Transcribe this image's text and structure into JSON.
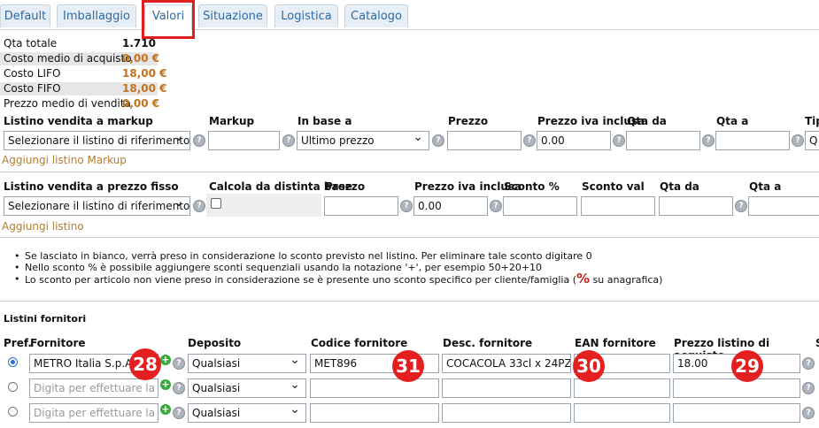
{
  "tabs": [
    "Default",
    "Imballaggio",
    "Valori",
    "Situazione",
    "Logistica",
    "Catalogo"
  ],
  "values": {
    "qta_totale_label": "Qta totale",
    "qta_totale_value": "1.710",
    "costo_medio_label": "Costo medio di acquisto",
    "costo_medio_value": "0,00 €",
    "costo_lifo_label": "Costo LIFO",
    "costo_lifo_value": "18,00 €",
    "costo_fifo_label": "Costo FIFO",
    "costo_fifo_value": "18,00 €",
    "prezzo_medio_label": "Prezzo medio di vendita",
    "prezzo_medio_value": "0,00 €"
  },
  "markup": {
    "headers": [
      "Listino vendita a markup",
      "Markup",
      "In base a",
      "Prezzo",
      "Prezzo iva inclusa",
      "Qta da",
      "Qta a",
      "Tip"
    ],
    "listino_select": "Selezionare il listino di riferimento",
    "in_base_select": "Ultimo prezzo",
    "prezzo_iva": "0.00",
    "tipo_value": "Q",
    "add_link": "Aggiungi listino Markup"
  },
  "fisso": {
    "headers": [
      "Listino vendita a prezzo fisso",
      "Calcola da distinta base",
      "Prezzo",
      "Prezzo iva inclusa",
      "Sconto %",
      "Sconto val",
      "Qta da",
      "Qta a"
    ],
    "listino_select": "Selezionare il listino di riferimento",
    "prezzo_iva": "0.00",
    "add_link": "Aggiungi listino"
  },
  "notes": {
    "n1": "Se lasciato in bianco, verrà preso in considerazione lo sconto previsto nel listino. Per eliminare tale sconto digitare 0",
    "n2": "Nello sconto % è possibile aggiungere sconti sequenziali usando la notazione '+', per esempio 50+20+10",
    "n3a": "Lo sconto per articolo non viene preso in considerazione se è presente uno sconto specifico per cliente/famiglia (",
    "n3b": " su anagrafica)",
    "pct": "%"
  },
  "fornitori": {
    "title": "Listini fornitori",
    "headers": [
      "Pref.",
      "Fornitore",
      "Deposito",
      "Codice fornitore",
      "Desc. fornitore",
      "EAN fornitore",
      "Prezzo listino di acquisto",
      "S"
    ],
    "rows": [
      {
        "fornitore": "METRO Italia S.p.A.",
        "deposito": "Qualsiasi",
        "codice": "MET896",
        "desc": "COCACOLA 33cl x 24PZ",
        "ean": "",
        "prezzo": "18.00"
      },
      {
        "fornitore_placeholder": "Digita per effettuare la ric",
        "deposito": "Qualsiasi"
      },
      {
        "fornitore_placeholder": "Digita per effettuare la ric",
        "deposito": "Qualsiasi"
      }
    ]
  },
  "badges": [
    "28",
    "31",
    "30",
    "29"
  ],
  "colors": {
    "accent": "#2b6aa6",
    "orange": "#c0731f",
    "badge": "#e41f1f",
    "highlight": "#e02020"
  }
}
